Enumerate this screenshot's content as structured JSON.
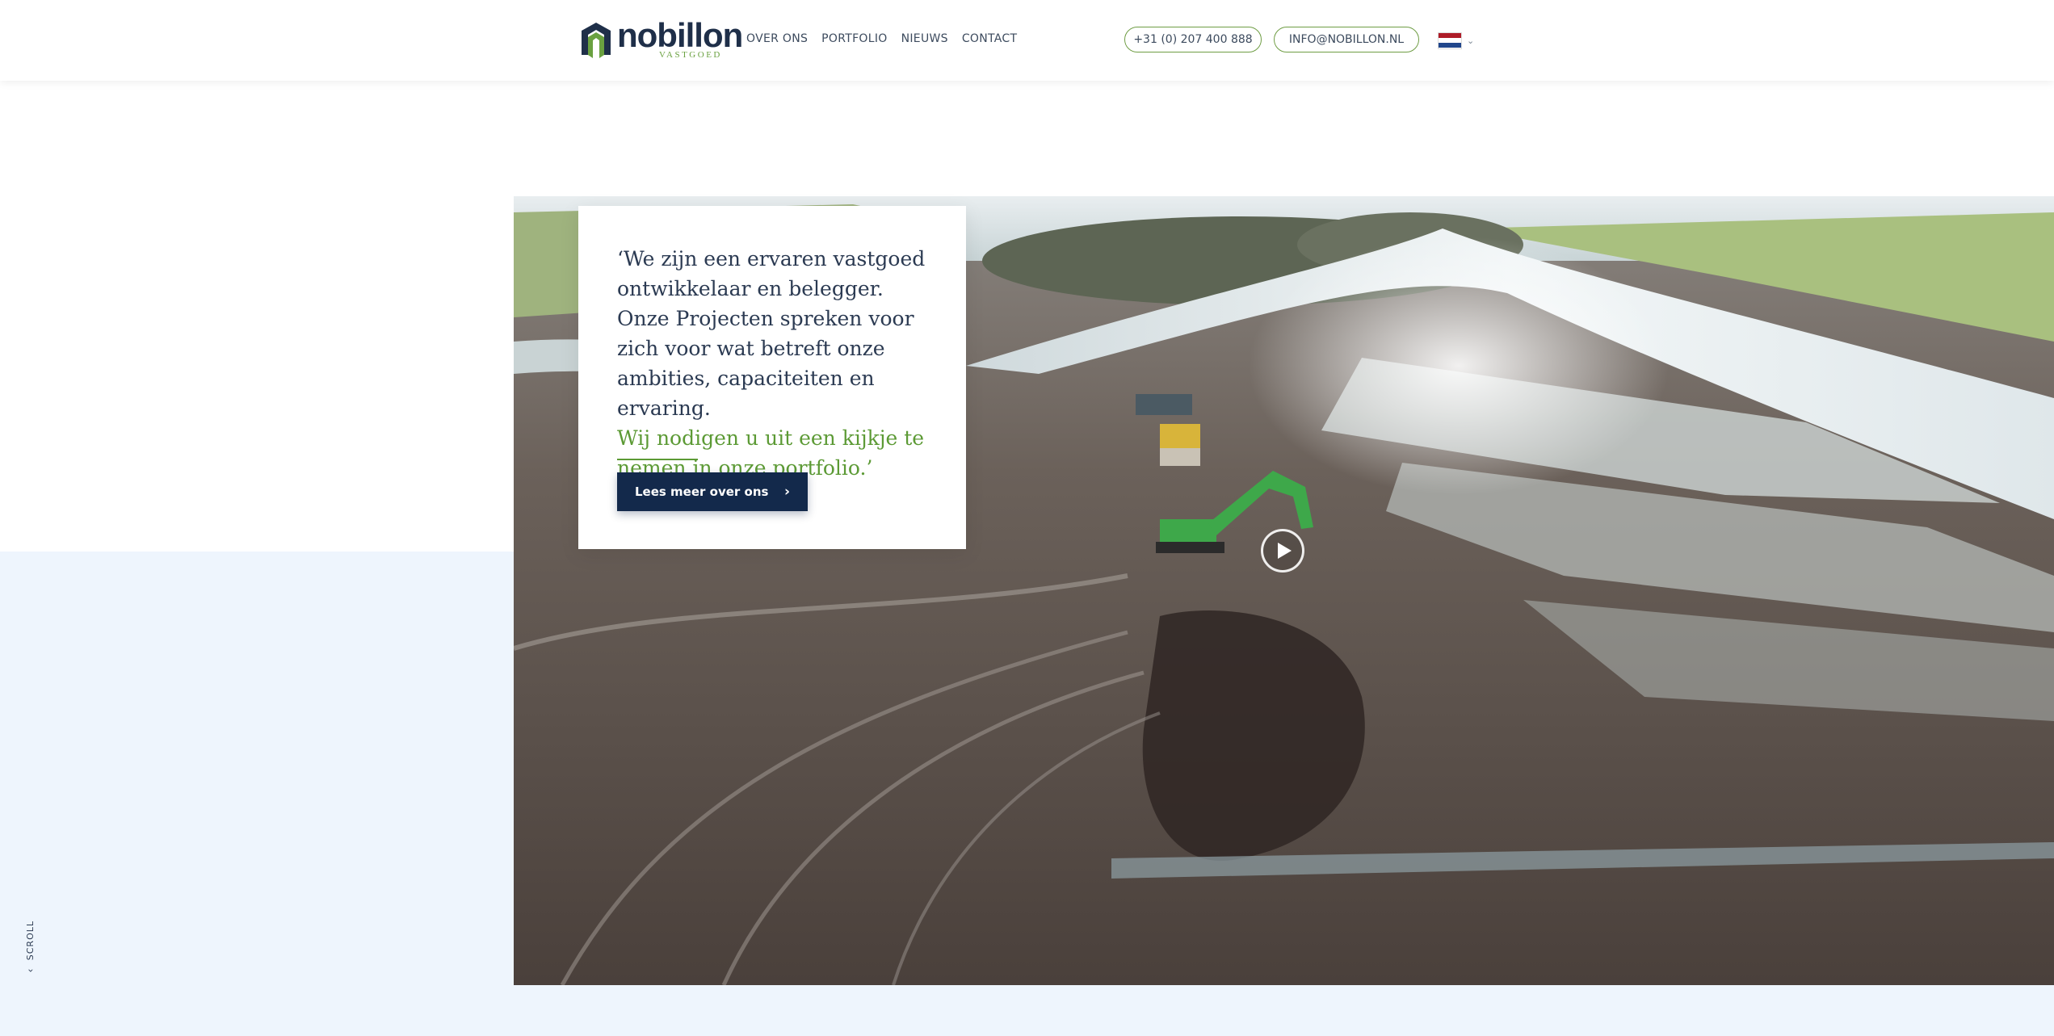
{
  "header": {
    "logo": {
      "name": "nobillon",
      "sub": "VASTGOED"
    },
    "nav": [
      {
        "label": "OVER ONS"
      },
      {
        "label": "PORTFOLIO"
      },
      {
        "label": "NIEUWS"
      },
      {
        "label": "CONTACT"
      }
    ],
    "phone": "+31 (0) 207 400 888",
    "email": "INFO@NOBILLON.NL",
    "language": {
      "icon": "netherlands-flag-icon",
      "chevron": "chevron-down-icon"
    }
  },
  "hero": {
    "quote_main": "‘We zijn een ervaren vastgoed ontwikkelaar en belegger. Onze Projecten spreken voor zich voor wat betreft onze ambities, capaciteiten en ervaring.",
    "quote_accent": "Wij nodigen u uit een kijkje te nemen in onze portfolio.’",
    "button_label": "Lees meer over ons",
    "button_icon": "chevron-right-icon",
    "play_icon": "play-icon"
  },
  "scroll": {
    "label": "SCROLL",
    "icon": "arrow-down-icon"
  },
  "colors": {
    "navy": "#13294b",
    "green": "#5c9a35",
    "band": "#eef5fd",
    "text": "#2b3a52"
  }
}
